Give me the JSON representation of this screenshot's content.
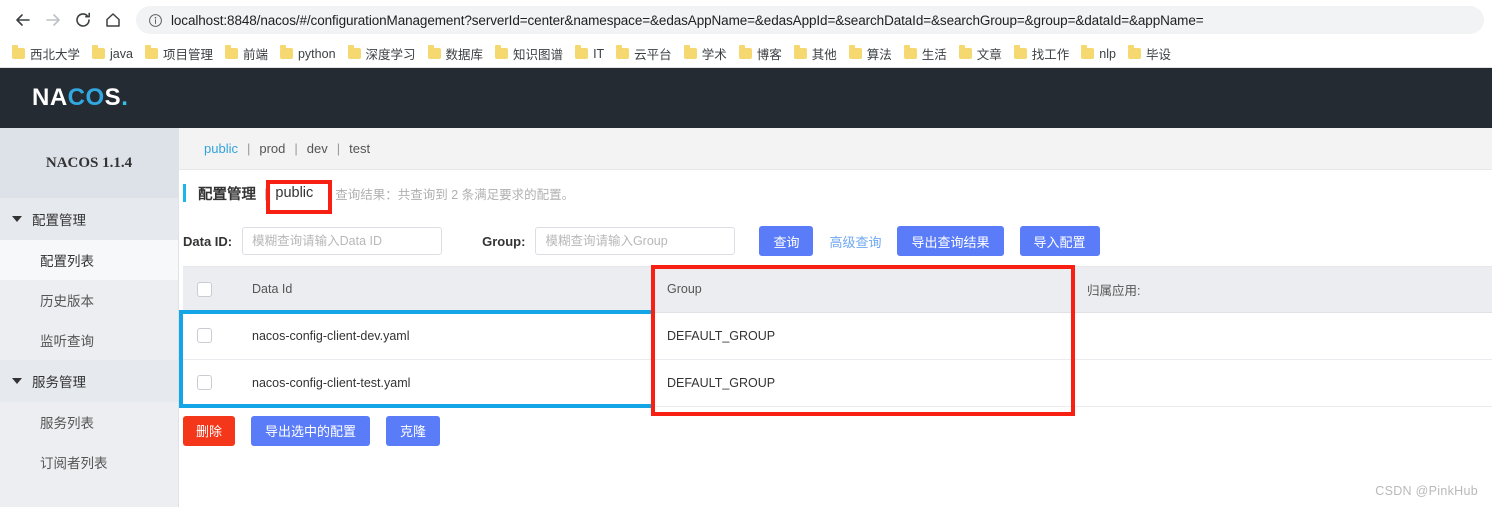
{
  "browser": {
    "back_icon": "back-arrow-icon",
    "forward_icon": "forward-arrow-icon",
    "reload_icon": "reload-icon",
    "home_icon": "home-icon",
    "info_icon": "info-circle-icon",
    "url": "localhost:8848/nacos/#/configurationManagement?serverId=center&namespace=&edasAppName=&edasAppId=&searchDataId=&searchGroup=&group=&dataId=&appName=",
    "bookmarks": [
      "西北大学",
      "java",
      "项目管理",
      "前端",
      "python",
      "深度学习",
      "数据库",
      "知识图谱",
      "IT",
      "云平台",
      "学术",
      "博客",
      "其他",
      "算法",
      "生活",
      "文章",
      "找工作",
      "nlp",
      "毕设"
    ]
  },
  "app": {
    "logo": {
      "part1": "NA",
      "part2": "CO",
      "part3": "S",
      "dot": "."
    },
    "sidebar": {
      "title": "NACOS 1.1.4",
      "groups": [
        {
          "label": "配置管理",
          "items": [
            {
              "label": "配置列表",
              "active": true
            },
            {
              "label": "历史版本",
              "active": false
            },
            {
              "label": "监听查询",
              "active": false
            }
          ]
        },
        {
          "label": "服务管理",
          "items": [
            {
              "label": "服务列表",
              "active": false
            },
            {
              "label": "订阅者列表",
              "active": false
            }
          ]
        }
      ]
    },
    "namespaces": {
      "active": "public",
      "others": [
        "prod",
        "dev",
        "test"
      ],
      "separator": "|"
    },
    "page": {
      "title": "配置管理",
      "title_separator": "|",
      "namespace_name": "public",
      "result_text": "查询结果：共查询到 2 条满足要求的配置。"
    },
    "search": {
      "dataid_label": "Data ID:",
      "dataid_placeholder": "模糊查询请输入Data ID",
      "dataid_value": "",
      "group_label": "Group:",
      "group_placeholder": "模糊查询请输入Group",
      "group_value": "",
      "query_button": "查询",
      "advanced_query_link": "高级查询",
      "export_result_button": "导出查询结果",
      "import_config_button": "导入配置"
    },
    "table": {
      "headers": {
        "checkbox": "",
        "data_id": "Data Id",
        "group": "Group",
        "app": "归属应用:"
      },
      "rows": [
        {
          "data_id": "nacos-config-client-dev.yaml",
          "group": "DEFAULT_GROUP",
          "app": ""
        },
        {
          "data_id": "nacos-config-client-test.yaml",
          "group": "DEFAULT_GROUP",
          "app": ""
        }
      ]
    },
    "actions": {
      "delete_button": "删除",
      "export_selected_button": "导出选中的配置",
      "clone_button": "克隆"
    },
    "watermark": "CSDN @PinkHub",
    "colors": {
      "accent_cyan": "#1db4e8",
      "primary_button": "#5a7cf8",
      "danger_button": "#f4371a",
      "header_dark": "#252b33",
      "annotation_red": "#f81f13",
      "annotation_cyan": "#13a5e6"
    }
  }
}
